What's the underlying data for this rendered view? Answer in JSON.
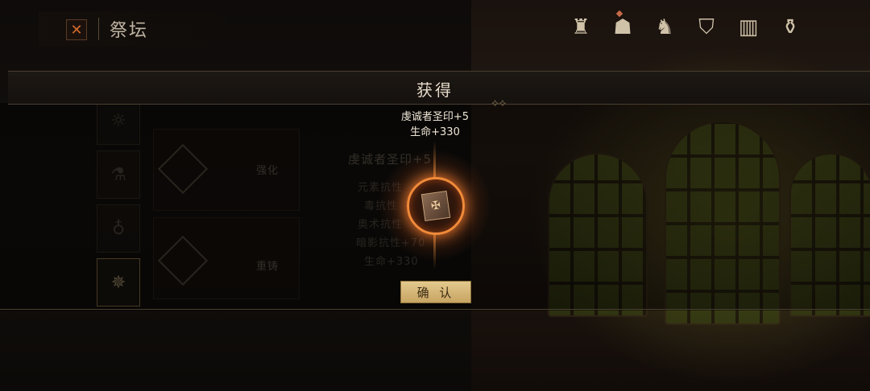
{
  "header": {
    "close_label": "✕",
    "title": "祭坛"
  },
  "top_icons": [
    {
      "name": "altar-icon",
      "glyph": "♜"
    },
    {
      "name": "hood-icon",
      "glyph": "☗",
      "badge": true
    },
    {
      "name": "beast-icon",
      "glyph": "♞"
    },
    {
      "name": "shield-icon",
      "glyph": "⛉"
    },
    {
      "name": "book-icon",
      "glyph": "▥"
    },
    {
      "name": "bag-icon",
      "glyph": "⚱"
    }
  ],
  "background_panel": {
    "tabs": [
      "强化",
      "重铸"
    ],
    "item_name": "虔诚者圣印+5",
    "stats": [
      "元素抗性",
      "毒抗性",
      "奥术抗性",
      "暗影抗性+70",
      "生命+330"
    ]
  },
  "dialog": {
    "title": "获得",
    "reward_name": "虔诚者圣印+5",
    "reward_stat": "生命+330",
    "confirm_label": "确 认"
  }
}
